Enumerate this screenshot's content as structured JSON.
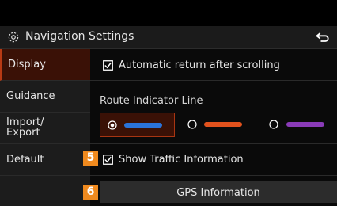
{
  "header": {
    "title": "Navigation Settings",
    "icon": "gear-icon",
    "back_icon": "back-arrow-icon"
  },
  "sidebar": {
    "items": [
      {
        "label": "Display",
        "active": true
      },
      {
        "label": "Guidance",
        "active": false
      },
      {
        "label": "Import/\nExport",
        "active": false
      },
      {
        "label": "Default",
        "active": false
      }
    ]
  },
  "main": {
    "auto_return": {
      "label": "Automatic return after scrolling",
      "checked": true
    },
    "route_line": {
      "title": "Route Indicator Line",
      "options": [
        {
          "color": "#2a73d9",
          "selected": true
        },
        {
          "color": "#e2521d",
          "selected": false
        },
        {
          "color": "#8a3bb8",
          "selected": false
        }
      ]
    },
    "traffic": {
      "label": "Show Traffic Information",
      "checked": true
    },
    "gps_button": "GPS Information"
  },
  "badges": {
    "traffic": "5",
    "gps": "6"
  },
  "colors": {
    "accent": "#b83a14",
    "badge": "#f08a1e"
  }
}
